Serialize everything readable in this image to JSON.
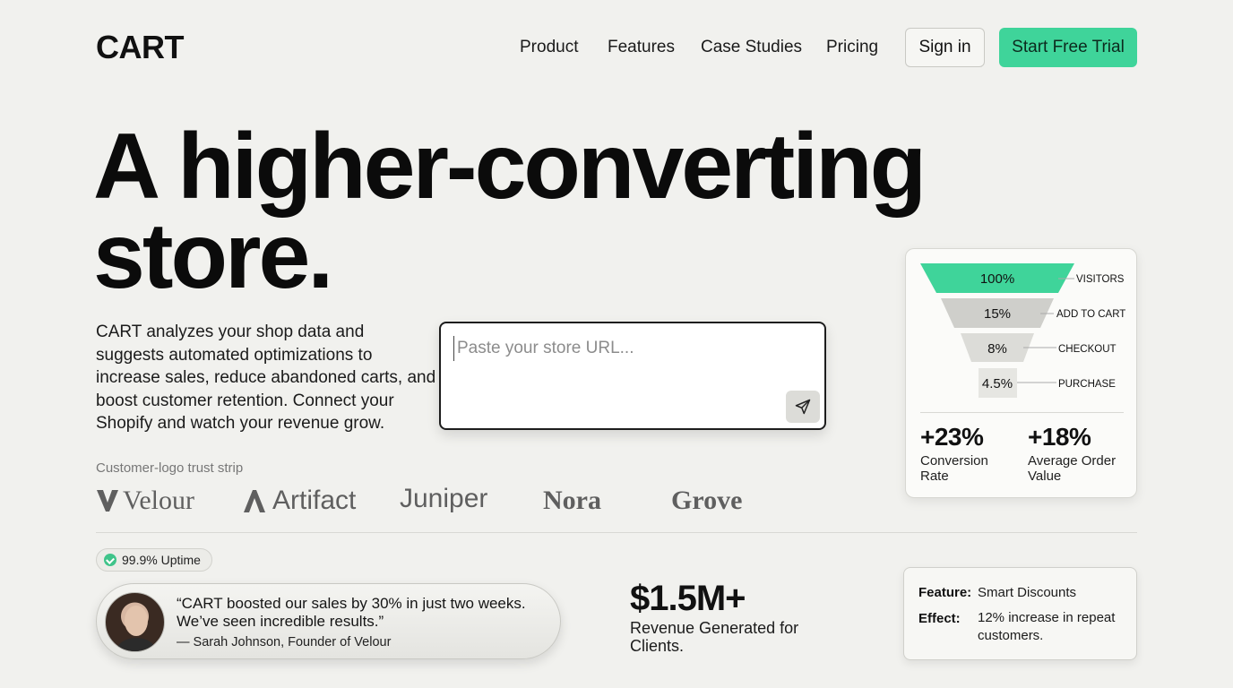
{
  "nav": {
    "logo": "CART",
    "links": [
      "Product",
      "Features",
      "Case Studies",
      "Pricing"
    ],
    "sign_in": "Sign in",
    "cta": "Start Free Trial"
  },
  "colors": {
    "accent": "#3fd49a",
    "background": "#f1f1ee"
  },
  "hero": {
    "line1": "A higher-converting",
    "line2": "store.",
    "description": "CART analyzes your shop data and suggests automated optimizations to increase sales, reduce abandoned carts, and boost customer retention. Connect your Shopify and watch your revenue grow."
  },
  "url_input": {
    "placeholder": "Paste your store URL...",
    "value": "",
    "send_icon": "send-icon"
  },
  "funnel": {
    "stages": [
      {
        "value": "100%",
        "label": "VISITORS"
      },
      {
        "value": "15%",
        "label": "ADD TO CART"
      },
      {
        "value": "8%",
        "label": "CHECKOUT"
      },
      {
        "value": "4.5%",
        "label": "PURCHASE"
      }
    ],
    "metrics": [
      {
        "value": "+23%",
        "label": "Conversion Rate"
      },
      {
        "value": "+18%",
        "label": "Average Order Value"
      }
    ]
  },
  "trust": {
    "label": "Customer-logo trust strip",
    "brands": [
      "Velour",
      "Artifact",
      "Juniper",
      "Nora",
      "Grove"
    ]
  },
  "uptime": "99.9% Uptime",
  "testimonial": {
    "quote": "“CART boosted our sales by 30% in just two weeks. We’ve seen incredible results.”",
    "author": "— Sarah Johnson, Founder of Velour"
  },
  "revenue": {
    "value": "$1.5M+",
    "label": "Revenue Generated for Clients."
  },
  "feature_card": {
    "feature_key": "Feature:",
    "feature_value": "Smart Discounts",
    "effect_key": "Effect:",
    "effect_value": "12% increase in repeat customers."
  }
}
